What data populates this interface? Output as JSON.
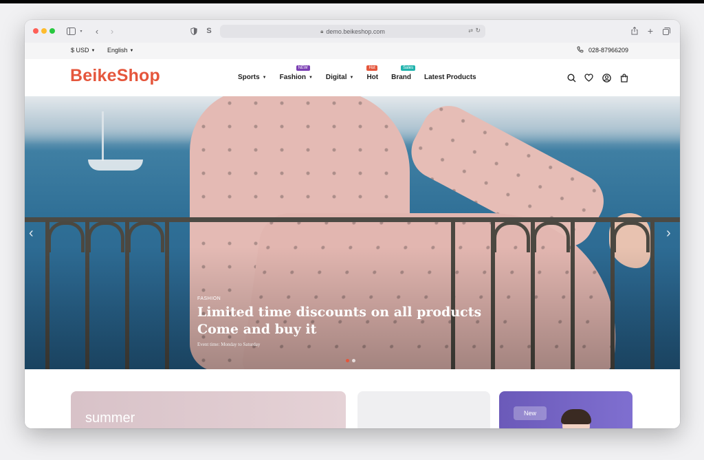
{
  "browser": {
    "url": "demo.beikeshop.com"
  },
  "utility": {
    "currency": "$ USD",
    "language": "English",
    "phone": "028-87966209"
  },
  "header": {
    "logo": "BeikeShop",
    "nav": [
      {
        "label": "Sports",
        "dropdown": true
      },
      {
        "label": "Fashion",
        "dropdown": true,
        "badge": "NEW",
        "badge_color": "#7b3fb3"
      },
      {
        "label": "Digital",
        "dropdown": true
      },
      {
        "label": "Hot",
        "dropdown": false,
        "badge": "Hot",
        "badge_color": "#e5563c"
      },
      {
        "label": "Brand",
        "dropdown": false,
        "badge": "Sales",
        "badge_color": "#21b3ad"
      },
      {
        "label": "Latest Products",
        "dropdown": false
      }
    ],
    "icons": [
      "search-icon",
      "heart-icon",
      "account-icon",
      "cart-icon"
    ]
  },
  "hero": {
    "tag": "FASHION",
    "title_line1": "Limited time discounts on all products",
    "title_line2": "Come and buy it",
    "subtitle": "Event time: Monday to Saturday",
    "slide_count": 2,
    "active_slide": 1
  },
  "cards": [
    {
      "text": "summer"
    },
    {
      "text": ""
    },
    {
      "badge": "New"
    }
  ],
  "colors": {
    "brand": "#e5563c",
    "badge_new": "#7b3fb3",
    "badge_hot": "#e5563c",
    "badge_sales": "#21b3ad"
  }
}
